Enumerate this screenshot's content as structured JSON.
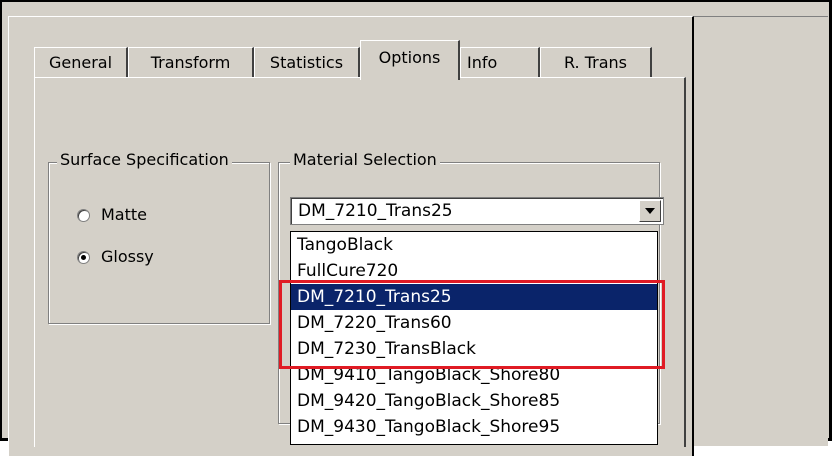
{
  "tabs": [
    {
      "label": "General",
      "active": false
    },
    {
      "label": "Transform",
      "active": false
    },
    {
      "label": "Statistics",
      "active": false
    },
    {
      "label": "Options",
      "active": true
    },
    {
      "label": "Info",
      "active": false
    },
    {
      "label": "R. Trans",
      "active": false
    }
  ],
  "surface_spec": {
    "legend": "Surface Specification",
    "options": [
      {
        "label": "Matte",
        "checked": false
      },
      {
        "label": "Glossy",
        "checked": true
      }
    ]
  },
  "material_selection": {
    "legend": "Material Selection",
    "selected_value": "DM_7210_Trans25",
    "dropdown_items": [
      {
        "label": "TangoBlack",
        "selected": false
      },
      {
        "label": "FullCure720",
        "selected": false
      },
      {
        "label": "DM_7210_Trans25",
        "selected": true
      },
      {
        "label": "DM_7220_Trans60",
        "selected": false
      },
      {
        "label": "DM_7230_TransBlack",
        "selected": false
      },
      {
        "label": "DM_9410_TangoBlack_Shore80",
        "selected": false
      },
      {
        "label": "DM_9420_TangoBlack_Shore85",
        "selected": false
      },
      {
        "label": "DM_9430_TangoBlack_Shore95",
        "selected": false
      }
    ]
  },
  "colors": {
    "selection_bg": "#0a246a",
    "annotation_red": "#e01b24",
    "dialog_bg": "#d4d0c8"
  },
  "icons": {
    "combo_button": "chevron-down-icon"
  }
}
